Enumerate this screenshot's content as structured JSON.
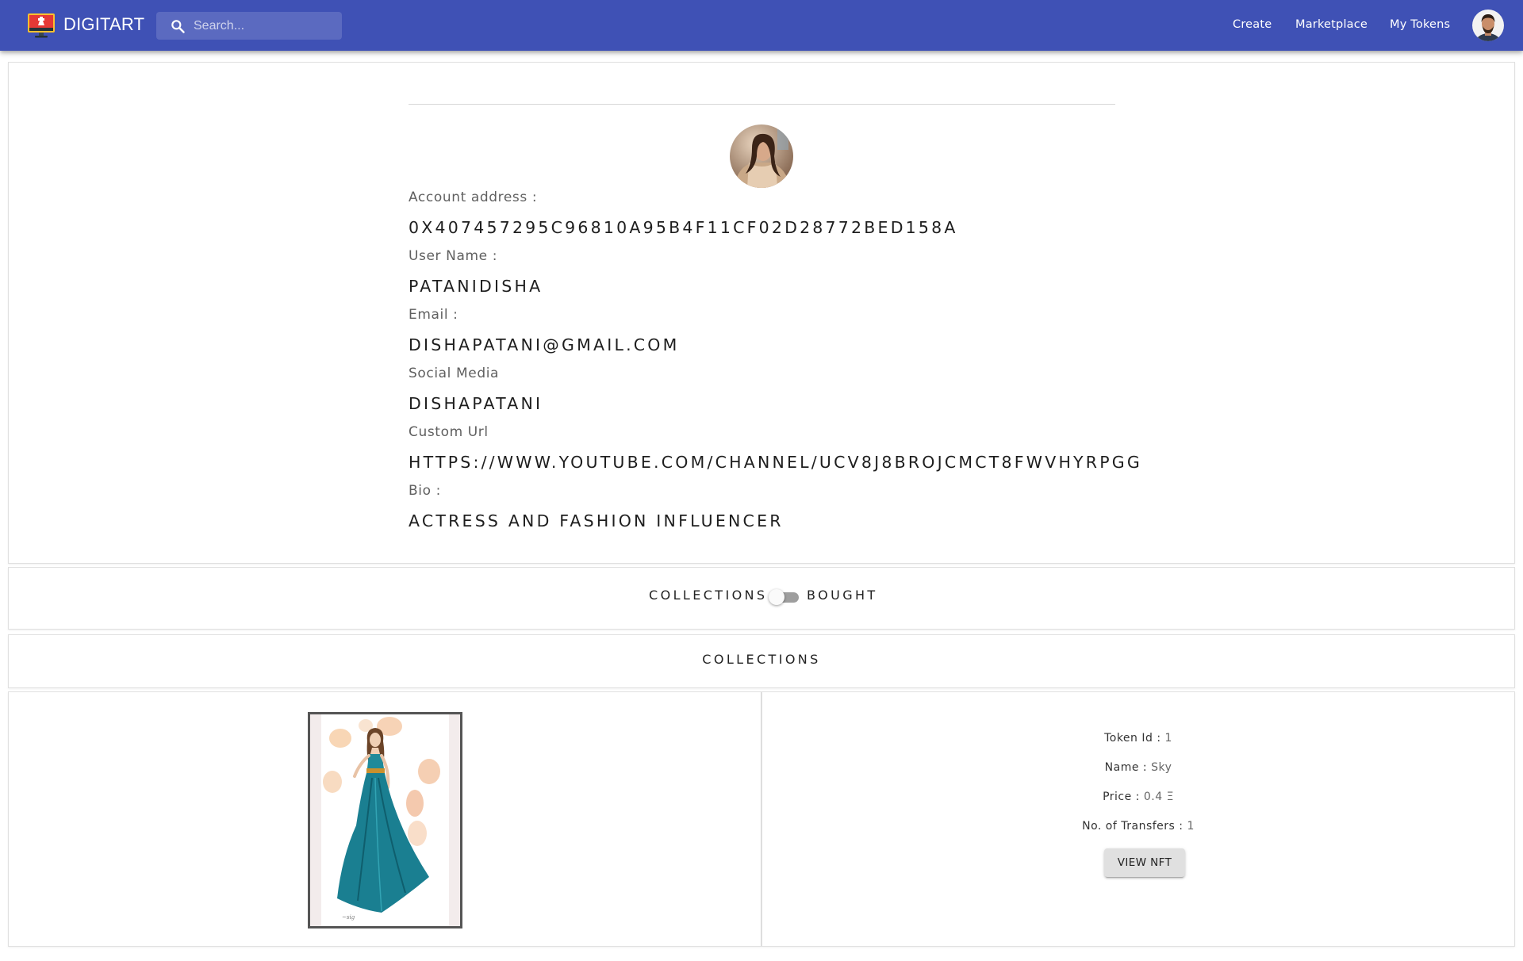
{
  "app": {
    "brand": "DIGITART",
    "logo_icon": "monitor-logo-icon"
  },
  "colors": {
    "appbar": "#3f51b5",
    "card_border": "#e0e0e0",
    "button_bg": "#e0e0e0"
  },
  "search": {
    "placeholder": "Search...",
    "icon": "search-icon"
  },
  "nav": {
    "create": "Create",
    "marketplace": "Marketplace",
    "my_tokens": "My Tokens",
    "avatar_icon": "user-avatar"
  },
  "profile": {
    "avatar": "profile-avatar",
    "account_label": "Account address :",
    "account_value": "0X407457295C96810A95B4F11CF02D28772BED158A",
    "username_label": "User Name :",
    "username_value": "PATANIDISHA",
    "email_label": "Email :",
    "email_value": "DISHAPATANI@GMAIL.COM",
    "social_label": "Social Media",
    "social_value": "DISHAPATANI",
    "url_label": "Custom Url",
    "url_value": "HTTPS://WWW.YOUTUBE.COM/CHANNEL/UCV8J8BROJCMCT8FWVHYRPGG",
    "bio_label": "Bio :",
    "bio_value": "ACTRESS AND FASHION INFLUENCER"
  },
  "toggle": {
    "left_label": "COLLECTIONS",
    "right_label": "BOUGHT",
    "checked": false
  },
  "section": {
    "title": "COLLECTIONS"
  },
  "nft": {
    "image": "fashion-illustration-image",
    "token_id_label": "Token Id :",
    "token_id": "1",
    "name_label": "Name :",
    "name": "Sky",
    "price_label": "Price :",
    "price": "0.4 Ξ",
    "transfers_label": "No. of Transfers :",
    "transfers": "1",
    "view_button": "VIEW NFT"
  }
}
